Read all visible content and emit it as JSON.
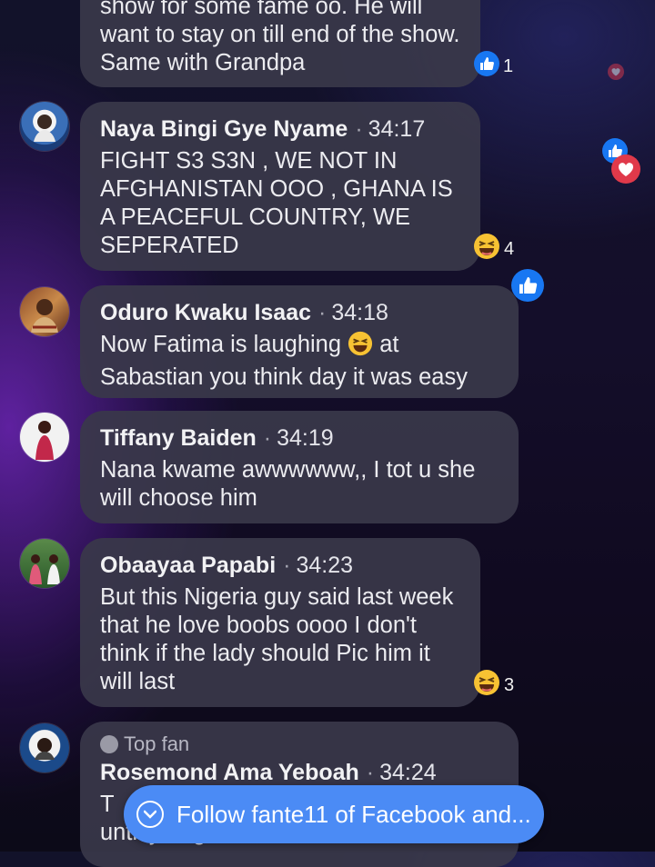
{
  "comments": [
    {
      "name": "",
      "time": "",
      "text_line1": "show for some fame oo. He will",
      "text_rest": "want to stay on till end of the show. Same with Grandpa",
      "reaction_icon": "like-icon",
      "reaction_count": "1"
    },
    {
      "name": "Naya Bingi Gye Nyame",
      "time": "34:17",
      "text": "FIGHT S3 S3N , WE NOT IN AFGHANISTAN OOO , GHANA IS A PEACEFUL COUNTRY,  WE SEPERATED",
      "reaction_icon": "laughing-emoji-icon",
      "reaction_count": "4"
    },
    {
      "name": "Oduro Kwaku Isaac",
      "time": "34:18",
      "text_before_emoji": "Now Fatima is laughing ",
      "text_after_emoji": " at Sabastian  you think day it was easy",
      "emoji": "laughing-emoji-icon"
    },
    {
      "name": "Tiffany Baiden",
      "time": "34:19",
      "text": "Nana kwame awwwwww,, I tot u she will choose him"
    },
    {
      "name": "Obaayaa Papabi",
      "time": "34:23",
      "text": "But this Nigeria guy said last week that he love boobs oooo I don't think if the lady should Pic him it will last",
      "reaction_icon": "laughing-emoji-icon",
      "reaction_count": "3"
    },
    {
      "badge": "Top fan",
      "name": "Rosemond Ama Yeboah",
      "time": "34:24",
      "text": "T",
      "text_partial": "until you got there...."
    }
  ],
  "follow_button": {
    "label": "Follow fante11 of Facebook and...",
    "icon": "chevron-down-icon"
  },
  "floating_reactions": [
    "heart-icon",
    "like-icon",
    "heart-icon",
    "like-icon"
  ],
  "colors": {
    "bubble": "#3a384a",
    "like_blue": "#1877f2",
    "heart_red": "#e0394a",
    "follow_blue": "#4b8bf5"
  }
}
